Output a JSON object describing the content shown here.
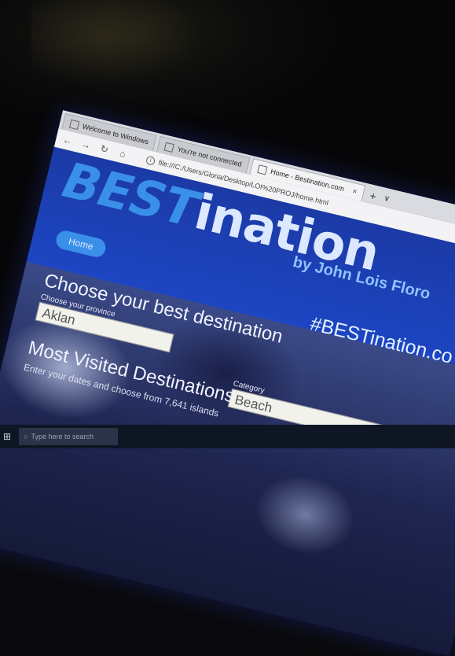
{
  "browser": {
    "tabs": [
      {
        "label": "Welcome to Windows"
      },
      {
        "label": "You're not connected"
      },
      {
        "label": "Home - Bestination.com",
        "active": true
      }
    ],
    "new_tab": "+",
    "tab_menu": "∨",
    "url": "file:///C:/Users/Gloria/Desktop/LOI%20PROJ/home.html",
    "nav_icons": [
      "back-icon",
      "forward-icon",
      "refresh-icon",
      "home-icon"
    ]
  },
  "site": {
    "brand_part1": "BEST",
    "brand_part2": "ination",
    "author": "by John Lois Floro",
    "menu": [
      "Home"
    ],
    "hashtag": "#BESTination.co"
  },
  "hero": {
    "choose_title": "Choose your best destination",
    "province_label": "Choose your province",
    "province_value": "Aklan",
    "category_label": "Category",
    "category_value": "Beach",
    "most_title": "Most Visited Destinations",
    "most_subtitle": "Enter your dates and choose from 7,641 islands"
  },
  "taskbar": {
    "search_placeholder": "Type here to search"
  },
  "colors": {
    "page_blue": "#1d46c4",
    "brand_light_blue": "#3a8fe8",
    "home_pill": "#3a8fe8",
    "menu_text": "#6e2f8a"
  }
}
